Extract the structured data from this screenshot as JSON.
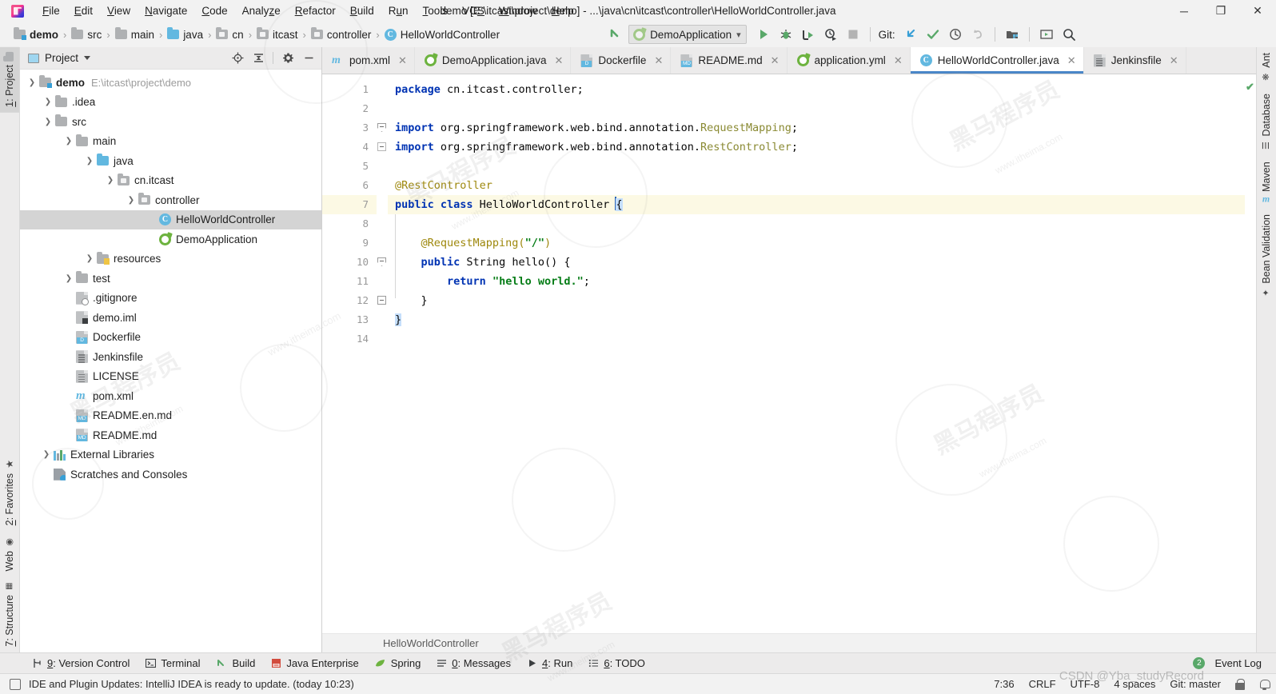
{
  "window": {
    "title": "demo [E:\\itcast\\project\\demo] - ...\\java\\cn\\itcast\\controller\\HelloWorldController.java",
    "minimize": "─",
    "maximize": "❐",
    "close": "✕",
    "logo_name": "intellij-idea-logo"
  },
  "menubar": [
    {
      "label": "File"
    },
    {
      "label": "Edit"
    },
    {
      "label": "View"
    },
    {
      "label": "Navigate"
    },
    {
      "label": "Code"
    },
    {
      "label": "Analyze"
    },
    {
      "label": "Refactor"
    },
    {
      "label": "Build"
    },
    {
      "label": "Run"
    },
    {
      "label": "Tools"
    },
    {
      "label": "VCS"
    },
    {
      "label": "Window"
    },
    {
      "label": "Help"
    }
  ],
  "navbar": {
    "crumbs": [
      {
        "label": "demo",
        "icon": "folder-module-icon"
      },
      {
        "label": "src",
        "icon": "folder-icon"
      },
      {
        "label": "main",
        "icon": "folder-icon"
      },
      {
        "label": "java",
        "icon": "folder-source-icon"
      },
      {
        "label": "cn",
        "icon": "package-icon"
      },
      {
        "label": "itcast",
        "icon": "package-icon"
      },
      {
        "label": "controller",
        "icon": "package-icon"
      },
      {
        "label": "HelloWorldController",
        "icon": "class-icon"
      }
    ],
    "separator": "›",
    "run_config": "DemoApplication",
    "git_label": "Git:",
    "buttons": [
      "back-arrow-icon",
      "run-icon",
      "debug-icon",
      "run-with-coverage-icon",
      "profile-icon",
      "stop-icon",
      "git-update-icon",
      "git-commit-icon",
      "git-history-icon",
      "git-rollback-icon",
      "project-structure-icon",
      "preview-icon",
      "search-everywhere-icon"
    ]
  },
  "left_stripe": {
    "top": [
      {
        "label": "1: Project",
        "icon": "project-icon",
        "active": true
      }
    ],
    "bottom": [
      {
        "label": "2: Favorites",
        "icon": "star-icon"
      },
      {
        "label": "Web",
        "icon": "web-icon"
      },
      {
        "label": "7: Structure",
        "icon": "structure-icon"
      }
    ]
  },
  "right_stripe": [
    {
      "label": "Ant",
      "icon": "ant-icon"
    },
    {
      "label": "Database",
      "icon": "database-icon"
    },
    {
      "label": "Maven",
      "icon": "maven-icon"
    },
    {
      "label": "Bean Validation",
      "icon": "bean-validation-icon"
    }
  ],
  "project_panel": {
    "title": "Project",
    "actions": [
      "locate-icon",
      "collapse-all-icon",
      "settings-gear-icon",
      "hide-icon"
    ],
    "tree": [
      {
        "indent": 0,
        "arrow": "down",
        "icon": "folder-module-icon",
        "label": "demo",
        "bold": true,
        "path": "E:\\itcast\\project\\demo"
      },
      {
        "indent": 1,
        "arrow": "right",
        "icon": "folder-icon",
        "label": ".idea"
      },
      {
        "indent": 1,
        "arrow": "down",
        "icon": "folder-icon",
        "label": "src"
      },
      {
        "indent": 2,
        "arrow": "down",
        "icon": "folder-icon",
        "label": "main"
      },
      {
        "indent": 3,
        "arrow": "down",
        "icon": "folder-source-icon",
        "label": "java"
      },
      {
        "indent": 4,
        "arrow": "down",
        "icon": "package-icon",
        "label": "cn.itcast"
      },
      {
        "indent": 5,
        "arrow": "down",
        "icon": "package-icon",
        "label": "controller"
      },
      {
        "indent": 6,
        "arrow": "none",
        "icon": "class-icon",
        "label": "HelloWorldController",
        "selected": true
      },
      {
        "indent": 6,
        "arrow": "none",
        "icon": "spring-boot-icon",
        "label": "DemoApplication"
      },
      {
        "indent": 3,
        "arrow": "right",
        "icon": "folder-resources-icon",
        "label": "resources"
      },
      {
        "indent": 2,
        "arrow": "right",
        "icon": "folder-icon",
        "label": "test"
      },
      {
        "indent": 2,
        "arrow": "none",
        "icon": "gitignore-file-icon",
        "label": ".gitignore"
      },
      {
        "indent": 2,
        "arrow": "none",
        "icon": "iml-file-icon",
        "label": "demo.iml"
      },
      {
        "indent": 2,
        "arrow": "none",
        "icon": "dockerfile-icon",
        "label": "Dockerfile"
      },
      {
        "indent": 2,
        "arrow": "none",
        "icon": "text-file-icon",
        "label": "Jenkinsfile"
      },
      {
        "indent": 2,
        "arrow": "none",
        "icon": "text-file-icon",
        "label": "LICENSE"
      },
      {
        "indent": 2,
        "arrow": "none",
        "icon": "maven-pom-icon",
        "label": "pom.xml"
      },
      {
        "indent": 2,
        "arrow": "none",
        "icon": "markdown-file-icon",
        "label": "README.en.md"
      },
      {
        "indent": 2,
        "arrow": "none",
        "icon": "markdown-file-icon",
        "label": "README.md"
      },
      {
        "indent": 0,
        "arrow": "right",
        "icon": "external-libraries-icon",
        "label": "External Libraries"
      },
      {
        "indent": 0,
        "arrow": "none",
        "icon": "scratches-icon",
        "label": "Scratches and Consoles"
      }
    ]
  },
  "editor": {
    "tabs": [
      {
        "label": "pom.xml",
        "icon": "maven-pom-icon",
        "active": false
      },
      {
        "label": "DemoApplication.java",
        "icon": "spring-boot-icon",
        "active": false
      },
      {
        "label": "Dockerfile",
        "icon": "dockerfile-icon",
        "active": false
      },
      {
        "label": "README.md",
        "icon": "markdown-file-icon",
        "active": false
      },
      {
        "label": "application.yml",
        "icon": "spring-yml-icon",
        "active": false
      },
      {
        "label": "HelloWorldController.java",
        "icon": "class-icon",
        "active": true
      },
      {
        "label": "Jenkinsfile",
        "icon": "text-file-icon",
        "active": false
      }
    ],
    "close_glyph": "✕",
    "breadcrumb": "HelloWorldController",
    "inspection_ok": "✔",
    "line_numbers": [
      "1",
      "2",
      "3",
      "4",
      "5",
      "6",
      "7",
      "8",
      "9",
      "10",
      "11",
      "12",
      "13",
      "14"
    ],
    "highlight_line": 7,
    "lines": [
      {
        "n": 1,
        "tokens": [
          {
            "t": "kw",
            "v": "package"
          },
          {
            "t": "plain",
            "v": " cn.itcast.controller;"
          }
        ]
      },
      {
        "n": 2,
        "tokens": []
      },
      {
        "n": 3,
        "tokens": [
          {
            "t": "kw",
            "v": "import"
          },
          {
            "t": "plain",
            "v": " org.springframework.web.bind.annotation."
          },
          {
            "t": "cls-ref",
            "v": "RequestMapping"
          },
          {
            "t": "plain",
            "v": ";"
          }
        ]
      },
      {
        "n": 4,
        "tokens": [
          {
            "t": "kw",
            "v": "import"
          },
          {
            "t": "plain",
            "v": " org.springframework.web.bind.annotation."
          },
          {
            "t": "cls-ref",
            "v": "RestController"
          },
          {
            "t": "plain",
            "v": ";"
          }
        ]
      },
      {
        "n": 5,
        "tokens": []
      },
      {
        "n": 6,
        "tokens": [
          {
            "t": "ann",
            "v": "@RestController"
          }
        ]
      },
      {
        "n": 7,
        "tokens": [
          {
            "t": "kw",
            "v": "public class"
          },
          {
            "t": "plain",
            "v": " HelloWorldController "
          },
          {
            "t": "caret",
            "v": ""
          },
          {
            "t": "brace",
            "v": "{"
          }
        ]
      },
      {
        "n": 8,
        "tokens": []
      },
      {
        "n": 9,
        "tokens": [
          {
            "t": "plain",
            "v": "    "
          },
          {
            "t": "ann",
            "v": "@RequestMapping("
          },
          {
            "t": "str",
            "v": "\"/\""
          },
          {
            "t": "ann",
            "v": ")"
          }
        ]
      },
      {
        "n": 10,
        "tokens": [
          {
            "t": "plain",
            "v": "    "
          },
          {
            "t": "kw",
            "v": "public"
          },
          {
            "t": "plain",
            "v": " String hello() {"
          }
        ]
      },
      {
        "n": 11,
        "tokens": [
          {
            "t": "plain",
            "v": "        "
          },
          {
            "t": "kw",
            "v": "return"
          },
          {
            "t": "plain",
            "v": " "
          },
          {
            "t": "str",
            "v": "\"hello world.\""
          },
          {
            "t": "plain",
            "v": ";"
          }
        ]
      },
      {
        "n": 12,
        "tokens": [
          {
            "t": "plain",
            "v": "    }"
          }
        ]
      },
      {
        "n": 13,
        "tokens": [
          {
            "t": "brace",
            "v": "}"
          }
        ]
      },
      {
        "n": 14,
        "tokens": []
      }
    ]
  },
  "bottom_bar": {
    "tools": [
      {
        "label": "9: Version Control",
        "icon": "version-control-icon"
      },
      {
        "label": "Terminal",
        "icon": "terminal-icon"
      },
      {
        "label": "Build",
        "icon": "build-hammer-icon"
      },
      {
        "label": "Java Enterprise",
        "icon": "java-enterprise-icon"
      },
      {
        "label": "Spring",
        "icon": "spring-leaf-icon"
      },
      {
        "label": "0: Messages",
        "icon": "messages-icon"
      },
      {
        "label": "4: Run",
        "icon": "run-icon"
      },
      {
        "label": "6: TODO",
        "icon": "todo-icon"
      }
    ],
    "event_log": {
      "label": "Event Log",
      "count": "2"
    }
  },
  "statusbar": {
    "message": "IDE and Plugin Updates: IntelliJ IDEA is ready to update. (today 10:23)",
    "caret_position": "7:36",
    "line_separator": "CRLF",
    "encoding": "UTF-8",
    "indent": "4 spaces",
    "branch": "Git: master",
    "icons": [
      "memory-indicator-icon",
      "lock-icon",
      "notification-bell-icon"
    ]
  },
  "watermark": {
    "site": "www.itheima.com",
    "csdn": "CSDN @Yba_studyRecord"
  },
  "colors": {
    "accent_blue": "#4a86c8",
    "tab_active_underline": "#4a86c8",
    "keyword": "#0033b3",
    "string": "#067d17",
    "annotation": "#9e880d",
    "class_ref": "#8a8a33",
    "selection": "#d4d4d4",
    "line_highlight": "#fcf9e4",
    "green": "#59a869",
    "icon_blue": "#62b8e0"
  }
}
